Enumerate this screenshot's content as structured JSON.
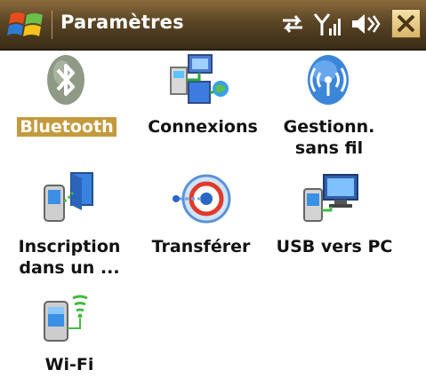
{
  "titlebar": {
    "title": "Paramètres",
    "start_icon": "windows-flag-icon",
    "status_icons": [
      "sync-arrows-icon",
      "signal-strength-icon",
      "speaker-icon"
    ],
    "close_label": "✕"
  },
  "items": [
    {
      "label1": "Bluetooth",
      "label2": "",
      "icon": "bluetooth-icon",
      "selected": true
    },
    {
      "label1": "Connexions",
      "label2": "",
      "icon": "connections-icon",
      "selected": false
    },
    {
      "label1": "Gestionn.",
      "label2": "sans fil",
      "icon": "wireless-manager-icon",
      "selected": false
    },
    {
      "label1": "Inscription",
      "label2": "dans un ...",
      "icon": "domain-enroll-icon",
      "selected": false
    },
    {
      "label1": "Transférer",
      "label2": "",
      "icon": "beam-icon",
      "selected": false
    },
    {
      "label1": "USB vers PC",
      "label2": "",
      "icon": "usb-to-pc-icon",
      "selected": false
    },
    {
      "label1": "Wi-Fi",
      "label2": "",
      "icon": "wifi-icon",
      "selected": false
    }
  ],
  "colors": {
    "titlebar": "#5a4526",
    "selection": "#c49a3e",
    "text": "#111111"
  }
}
